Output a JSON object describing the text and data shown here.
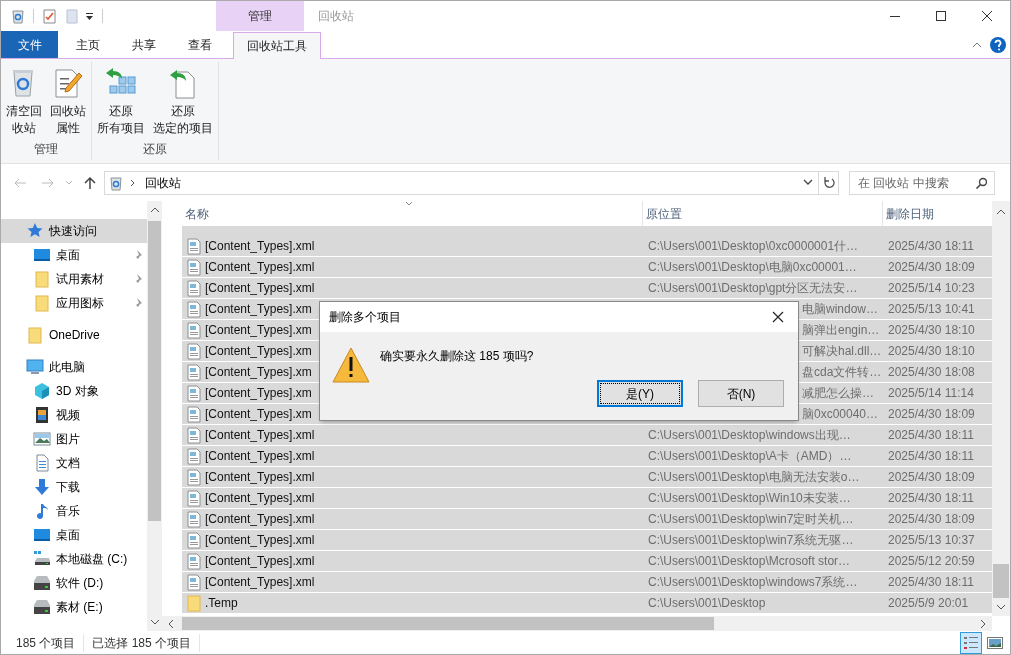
{
  "window": {
    "title": "回收站",
    "context_tab": "管理"
  },
  "ribbon_tabs": [
    {
      "label": "文件",
      "kind": "file",
      "selected": false
    },
    {
      "label": "主页",
      "kind": "tab",
      "selected": false
    },
    {
      "label": "共享",
      "kind": "tab",
      "selected": false
    },
    {
      "label": "查看",
      "kind": "tab",
      "selected": false
    },
    {
      "label": "回收站工具",
      "kind": "tab",
      "selected": true
    }
  ],
  "ribbon_groups": [
    {
      "label": "管理",
      "buttons": [
        {
          "kind": "empty-bin",
          "lines": [
            "清空回",
            "收站"
          ]
        },
        {
          "kind": "properties",
          "lines": [
            "回收站",
            "属性"
          ]
        }
      ]
    },
    {
      "label": "还原",
      "buttons": [
        {
          "kind": "restore-all",
          "lines": [
            "还原",
            "所有项目"
          ]
        },
        {
          "kind": "restore-selected",
          "lines": [
            "还原",
            "选定的项目"
          ]
        }
      ]
    }
  ],
  "address": {
    "path": "回收站"
  },
  "search": {
    "placeholder": "在 回收站 中搜索"
  },
  "nav": [
    {
      "kind": "star",
      "label": "快速访问",
      "selected": true,
      "pinned": false,
      "children": [
        {
          "kind": "desktop",
          "label": "桌面",
          "selected": false,
          "pinned": true
        },
        {
          "kind": "folder",
          "label": "试用素材",
          "selected": false,
          "pinned": true
        },
        {
          "kind": "folder",
          "label": "应用图标",
          "selected": false,
          "pinned": true
        }
      ]
    },
    {
      "kind": "folder",
      "label": "OneDrive",
      "selected": false,
      "pinned": false
    },
    {
      "kind": "pc",
      "label": "此电脑",
      "selected": false,
      "pinned": false,
      "children": [
        {
          "kind": "cube",
          "label": "3D 对象",
          "selected": false,
          "pinned": false
        },
        {
          "kind": "film",
          "label": "视频",
          "selected": false,
          "pinned": false
        },
        {
          "kind": "image",
          "label": "图片",
          "selected": false,
          "pinned": false
        },
        {
          "kind": "doc",
          "label": "文档",
          "selected": false,
          "pinned": false
        },
        {
          "kind": "download",
          "label": "下载",
          "selected": false,
          "pinned": false
        },
        {
          "kind": "music",
          "label": "音乐",
          "selected": false,
          "pinned": false
        },
        {
          "kind": "desktop",
          "label": "桌面",
          "selected": false,
          "pinned": false
        },
        {
          "kind": "system-drive",
          "label": "本地磁盘 (C:)",
          "selected": false,
          "pinned": false
        },
        {
          "kind": "drive",
          "label": "软件 (D:)",
          "selected": false,
          "pinned": false
        },
        {
          "kind": "drive",
          "label": "素材 (E:)",
          "selected": false,
          "pinned": false
        }
      ]
    }
  ],
  "columns": [
    {
      "label": "名称",
      "sorted": true
    },
    {
      "label": "原位置",
      "sorted": false
    },
    {
      "label": "删除日期",
      "sorted": false
    }
  ],
  "rows": [
    {
      "kind": "file",
      "name": "[Content_Types].xml",
      "location": "C:\\Users\\001\\Desktop\\0xc0000001什…",
      "date": "2025/4/30 18:11",
      "selected": true,
      "under_dialog": false
    },
    {
      "kind": "file",
      "name": "[Content_Types].xml",
      "location": "C:\\Users\\001\\Desktop\\电脑0xc00001…",
      "date": "2025/4/30 18:09",
      "selected": true,
      "under_dialog": false
    },
    {
      "kind": "file",
      "name": "[Content_Types].xml",
      "location": "C:\\Users\\001\\Desktop\\gpt分区无法安…",
      "date": "2025/5/14 10:23",
      "selected": true,
      "under_dialog": false
    },
    {
      "kind": "file",
      "name": "[Content_Types].xm",
      "location": "电脑window…",
      "date": "2025/5/13 10:41",
      "selected": true,
      "under_dialog": true
    },
    {
      "kind": "file",
      "name": "[Content_Types].xm",
      "location": "脑弹出engin…",
      "date": "2025/4/30 18:10",
      "selected": true,
      "under_dialog": true
    },
    {
      "kind": "file",
      "name": "[Content_Types].xm",
      "location": "可解决hal.dll…",
      "date": "2025/4/30 18:10",
      "selected": true,
      "under_dialog": true
    },
    {
      "kind": "file",
      "name": "[Content_Types].xm",
      "location": "盘cda文件转…",
      "date": "2025/4/30 18:08",
      "selected": true,
      "under_dialog": true
    },
    {
      "kind": "file",
      "name": "[Content_Types].xm",
      "location": "减肥怎么操…",
      "date": "2025/5/14 11:14",
      "selected": true,
      "under_dialog": true
    },
    {
      "kind": "file",
      "name": "[Content_Types].xm",
      "location": "脑0xc00040…",
      "date": "2025/4/30 18:09",
      "selected": true,
      "under_dialog": true
    },
    {
      "kind": "file",
      "name": "[Content_Types].xml",
      "location": "C:\\Users\\001\\Desktop\\windows出现…",
      "date": "2025/4/30 18:11",
      "selected": true,
      "under_dialog": false
    },
    {
      "kind": "file",
      "name": "[Content_Types].xml",
      "location": "C:\\Users\\001\\Desktop\\A卡（AMD）…",
      "date": "2025/4/30 18:11",
      "selected": true,
      "under_dialog": false
    },
    {
      "kind": "file",
      "name": "[Content_Types].xml",
      "location": "C:\\Users\\001\\Desktop\\电脑无法安装o…",
      "date": "2025/4/30 18:09",
      "selected": true,
      "under_dialog": false
    },
    {
      "kind": "file",
      "name": "[Content_Types].xml",
      "location": "C:\\Users\\001\\Desktop\\Win10未安装…",
      "date": "2025/4/30 18:11",
      "selected": true,
      "under_dialog": false
    },
    {
      "kind": "file",
      "name": "[Content_Types].xml",
      "location": "C:\\Users\\001\\Desktop\\win7定时关机…",
      "date": "2025/4/30 18:09",
      "selected": true,
      "under_dialog": false
    },
    {
      "kind": "file",
      "name": "[Content_Types].xml",
      "location": "C:\\Users\\001\\Desktop\\win7系统无驱…",
      "date": "2025/5/13 10:37",
      "selected": true,
      "under_dialog": false
    },
    {
      "kind": "file",
      "name": "[Content_Types].xml",
      "location": "C:\\Users\\001\\Desktop\\Mcrosoft stor…",
      "date": "2025/5/12 20:59",
      "selected": true,
      "under_dialog": false
    },
    {
      "kind": "file",
      "name": "[Content_Types].xml",
      "location": "C:\\Users\\001\\Desktop\\windows7系统…",
      "date": "2025/4/30 18:11",
      "selected": true,
      "under_dialog": false
    },
    {
      "kind": "folder",
      "name": ".Temp",
      "location": "C:\\Users\\001\\Desktop",
      "date": "2025/5/9 20:01",
      "selected": true,
      "under_dialog": false
    }
  ],
  "dialog": {
    "title": "删除多个项目",
    "message": "确实要永久删除这 185 项吗?",
    "buttons": [
      {
        "label": "是(Y)",
        "focused": true
      },
      {
        "label": "否(N)",
        "focused": false
      }
    ]
  },
  "status_bar": {
    "count": "185 个项目",
    "selection": "已选择 185 个项目"
  },
  "view_buttons": [
    {
      "kind": "details",
      "selected": true
    },
    {
      "kind": "large-icons",
      "selected": false
    }
  ]
}
